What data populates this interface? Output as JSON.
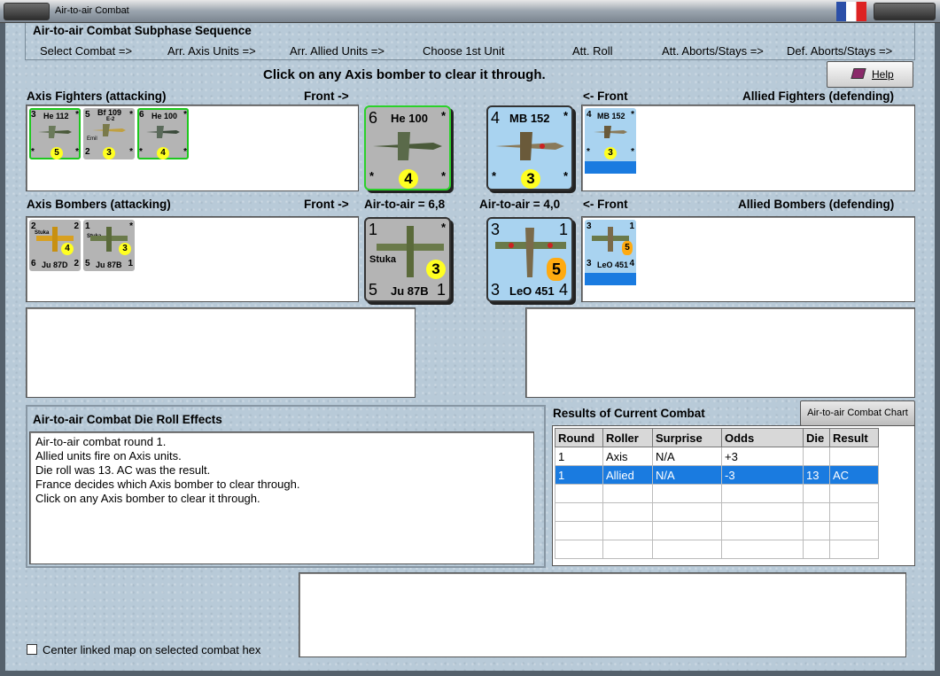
{
  "window": {
    "title": "Air-to-air Combat"
  },
  "sequence": {
    "title": "Air-to-air Combat Subphase Sequence",
    "steps": [
      "Select Combat =>",
      "Arr. Axis Units =>",
      "Arr. Allied Units =>",
      "Choose 1st Unit",
      "Att. Roll",
      "Att. Aborts/Stays =>",
      "Def. Aborts/Stays =>"
    ]
  },
  "instruction": "Click on any Axis bomber to clear it through.",
  "help_label": "Help",
  "labels": {
    "axis_fighters": "Axis Fighters (attacking)",
    "front_right": "Front ->",
    "front_left": "<- Front",
    "allied_fighters": "Allied Fighters (defending)",
    "axis_bombers": "Axis Bombers (attacking)",
    "front_right2": "Front ->",
    "air_to_air_axis": "Air-to-air = 6,8",
    "air_to_air_allied": "Air-to-air = 4,0",
    "front_left2": "<- Front",
    "allied_bombers": "Allied Bombers (defending)"
  },
  "axis_fighters": [
    {
      "a": "3",
      "name": "He 112",
      "b": "*",
      "c": "*",
      "d": "*",
      "die": "5"
    },
    {
      "a": "5",
      "name": "Bf 109",
      "sub": "E-2",
      "sub2": "Emil",
      "b": "*",
      "c": "2",
      "d": "*",
      "die": "3"
    },
    {
      "a": "6",
      "name": "He 100",
      "b": "*",
      "c": "*",
      "d": "*",
      "die": "4"
    }
  ],
  "axis_fighter_big": {
    "a": "6",
    "name": "He 100",
    "b": "*",
    "c": "*",
    "d": "*",
    "die": "4"
  },
  "allied_fighter_big": {
    "a": "4",
    "name": "MB 152",
    "b": "*",
    "c": "*",
    "d": "*",
    "die": "3"
  },
  "allied_fighters": [
    {
      "a": "4",
      "name": "MB 152",
      "b": "*",
      "c": "*",
      "d": "*",
      "die": "3"
    }
  ],
  "axis_bombers": [
    {
      "a": "2",
      "name": "Ju 87D",
      "b": "2",
      "c": "6",
      "d": "2",
      "die": "4",
      "tag": "Stuka"
    },
    {
      "a": "1",
      "name": "Ju 87B",
      "b": "*",
      "c": "5",
      "d": "1",
      "die": "3",
      "tag": "Stuka"
    }
  ],
  "axis_bomber_big": {
    "a": "1",
    "name": "Ju 87B",
    "tag": "Stuka",
    "b": "*",
    "c": "5",
    "d": "1",
    "die": "3"
  },
  "allied_bomber_big": {
    "a": "3",
    "name": "LeO 451",
    "b": "1",
    "c": "3",
    "d": "4",
    "die": "5"
  },
  "allied_bombers": [
    {
      "a": "3",
      "name": "LeO 451",
      "b": "1",
      "c": "3",
      "d": "4",
      "die": "5"
    }
  ],
  "effects": {
    "title": "Air-to-air Combat Die Roll Effects",
    "lines": [
      "Air-to-air combat round 1.",
      "Allied units fire on Axis units.",
      "Die roll was 13.  AC was the result.",
      "France decides which Axis bomber to clear through.",
      "Click on any Axis bomber to clear it through."
    ]
  },
  "results": {
    "title": "Results of Current Combat",
    "chart_button": "Air-to-air Combat Chart",
    "columns": [
      "Round",
      "Roller",
      "Surprise",
      "Odds",
      "Die",
      "Result"
    ],
    "rows": [
      [
        "1",
        "Axis",
        "N/A",
        "+3",
        "",
        ""
      ],
      [
        "1",
        "Allied",
        "N/A",
        "-3",
        "13",
        "AC"
      ]
    ]
  },
  "center_checkbox": "Center linked map on selected combat hex",
  "colors": {
    "highlight": "#1a7be0",
    "die": "#ffff22",
    "allied_card": "#a9d3f0",
    "axis_card": "#b4b4b4",
    "selected_outline": "#1ec81e"
  }
}
